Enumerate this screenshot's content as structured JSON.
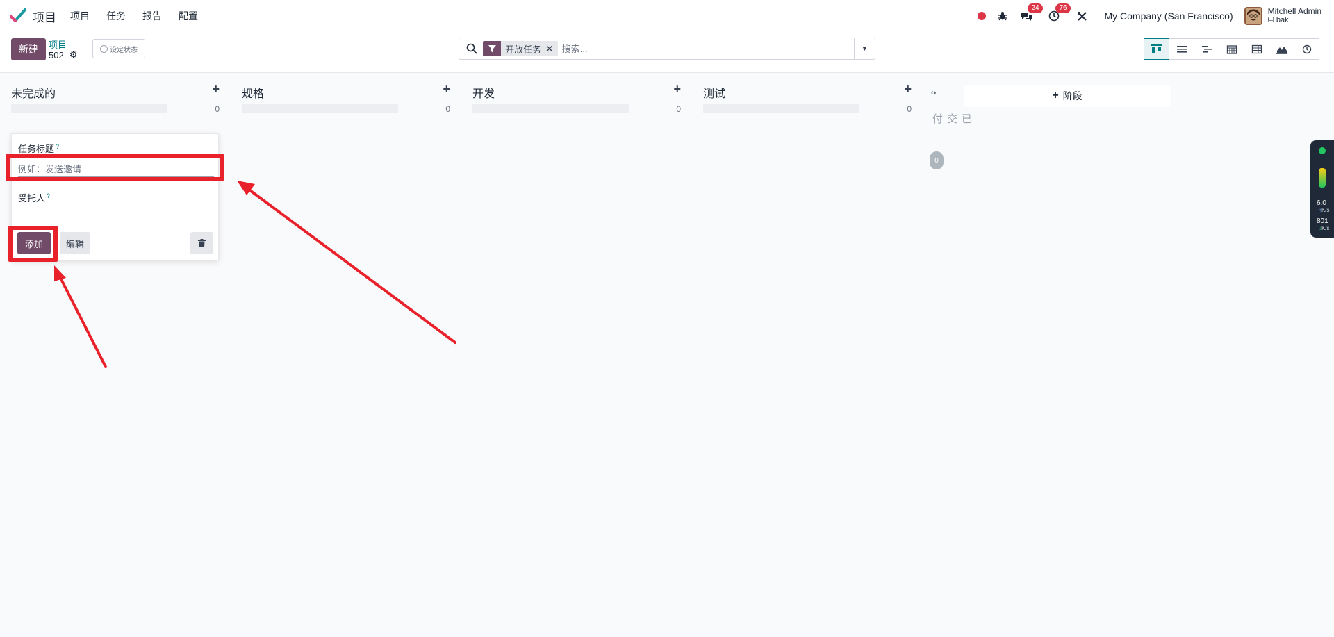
{
  "navbar": {
    "app_name": "项目",
    "menu": [
      "项目",
      "任务",
      "报告",
      "配置"
    ],
    "messages_count": "24",
    "activities_count": "76",
    "company": "My Company (San Francisco)",
    "user_name": "Mitchell Admin",
    "user_db": "bak"
  },
  "control": {
    "new_label": "新建",
    "breadcrumb_parent": "项目",
    "breadcrumb_current": "502",
    "status_label": "设定状态",
    "search_facet": "开放任务",
    "search_placeholder": "搜索..."
  },
  "views": [
    "kanban-view",
    "list-view",
    "gantt-view",
    "calendar-view",
    "pivot-view",
    "graph-view",
    "activity-view"
  ],
  "kanban": {
    "columns": [
      {
        "title": "未完成的",
        "count": "0"
      },
      {
        "title": "规格",
        "count": "0"
      },
      {
        "title": "开发",
        "count": "0"
      },
      {
        "title": "测试",
        "count": "0"
      }
    ],
    "folded": {
      "title": "已交付",
      "count": "0"
    },
    "add_stage_label": "阶段"
  },
  "quick_create": {
    "title_label": "任务标题",
    "title_help": "?",
    "title_placeholder": "例如：发送邀请",
    "assignee_label": "受托人",
    "assignee_help": "?",
    "add_label": "添加",
    "edit_label": "编辑"
  },
  "widget": {
    "upload_value": "6.0",
    "upload_unit": "K/s",
    "download_value": "801",
    "download_unit": "K/s"
  },
  "colors": {
    "brand": "#714b67",
    "accent": "#017e84",
    "annotation": "#e8212a"
  }
}
